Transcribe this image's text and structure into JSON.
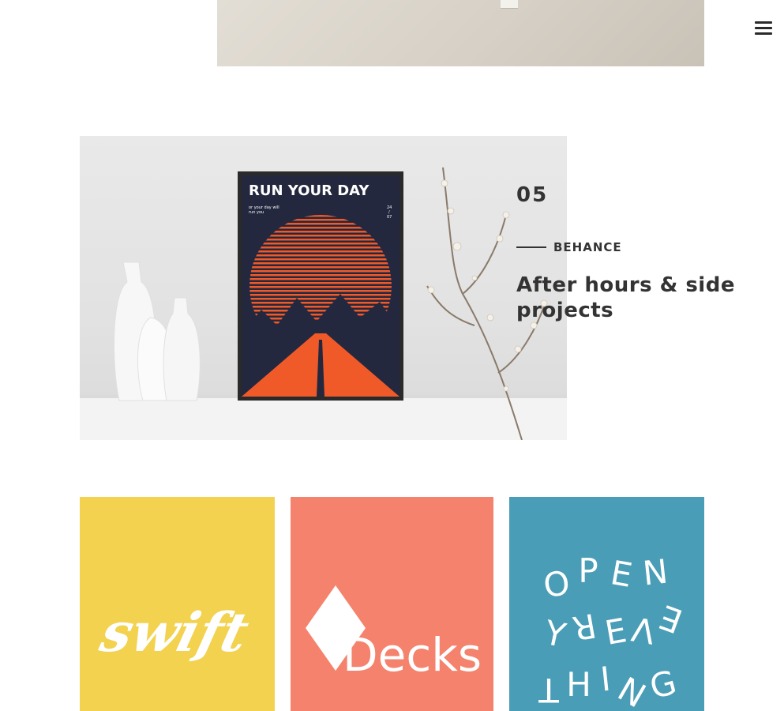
{
  "header": {
    "menu_icon": "hamburger-menu-icon"
  },
  "poster": {
    "headline": "RUN YOUR DAY",
    "subline_1": "or your day will",
    "subline_2": "run you",
    "date_day": "24",
    "date_sep": "/",
    "date_month": "07"
  },
  "project": {
    "number": "05",
    "category": "BEHANCE",
    "title": "After hours & side projects"
  },
  "tiles": {
    "swift": {
      "logo_text": "swift"
    },
    "decks": {
      "logo_text": "Decks"
    },
    "open": {
      "letters": [
        "O",
        "P",
        "E",
        "N",
        "Y",
        "R",
        "E",
        "V",
        "E",
        "T",
        "H",
        "I",
        "N",
        "G"
      ]
    }
  },
  "colors": {
    "swift_bg": "#f3d24f",
    "decks_bg": "#f4826c",
    "open_bg": "#4a9db6",
    "poster_navy": "#23283f",
    "poster_orange": "#f05a28",
    "text_dark": "#333333"
  }
}
